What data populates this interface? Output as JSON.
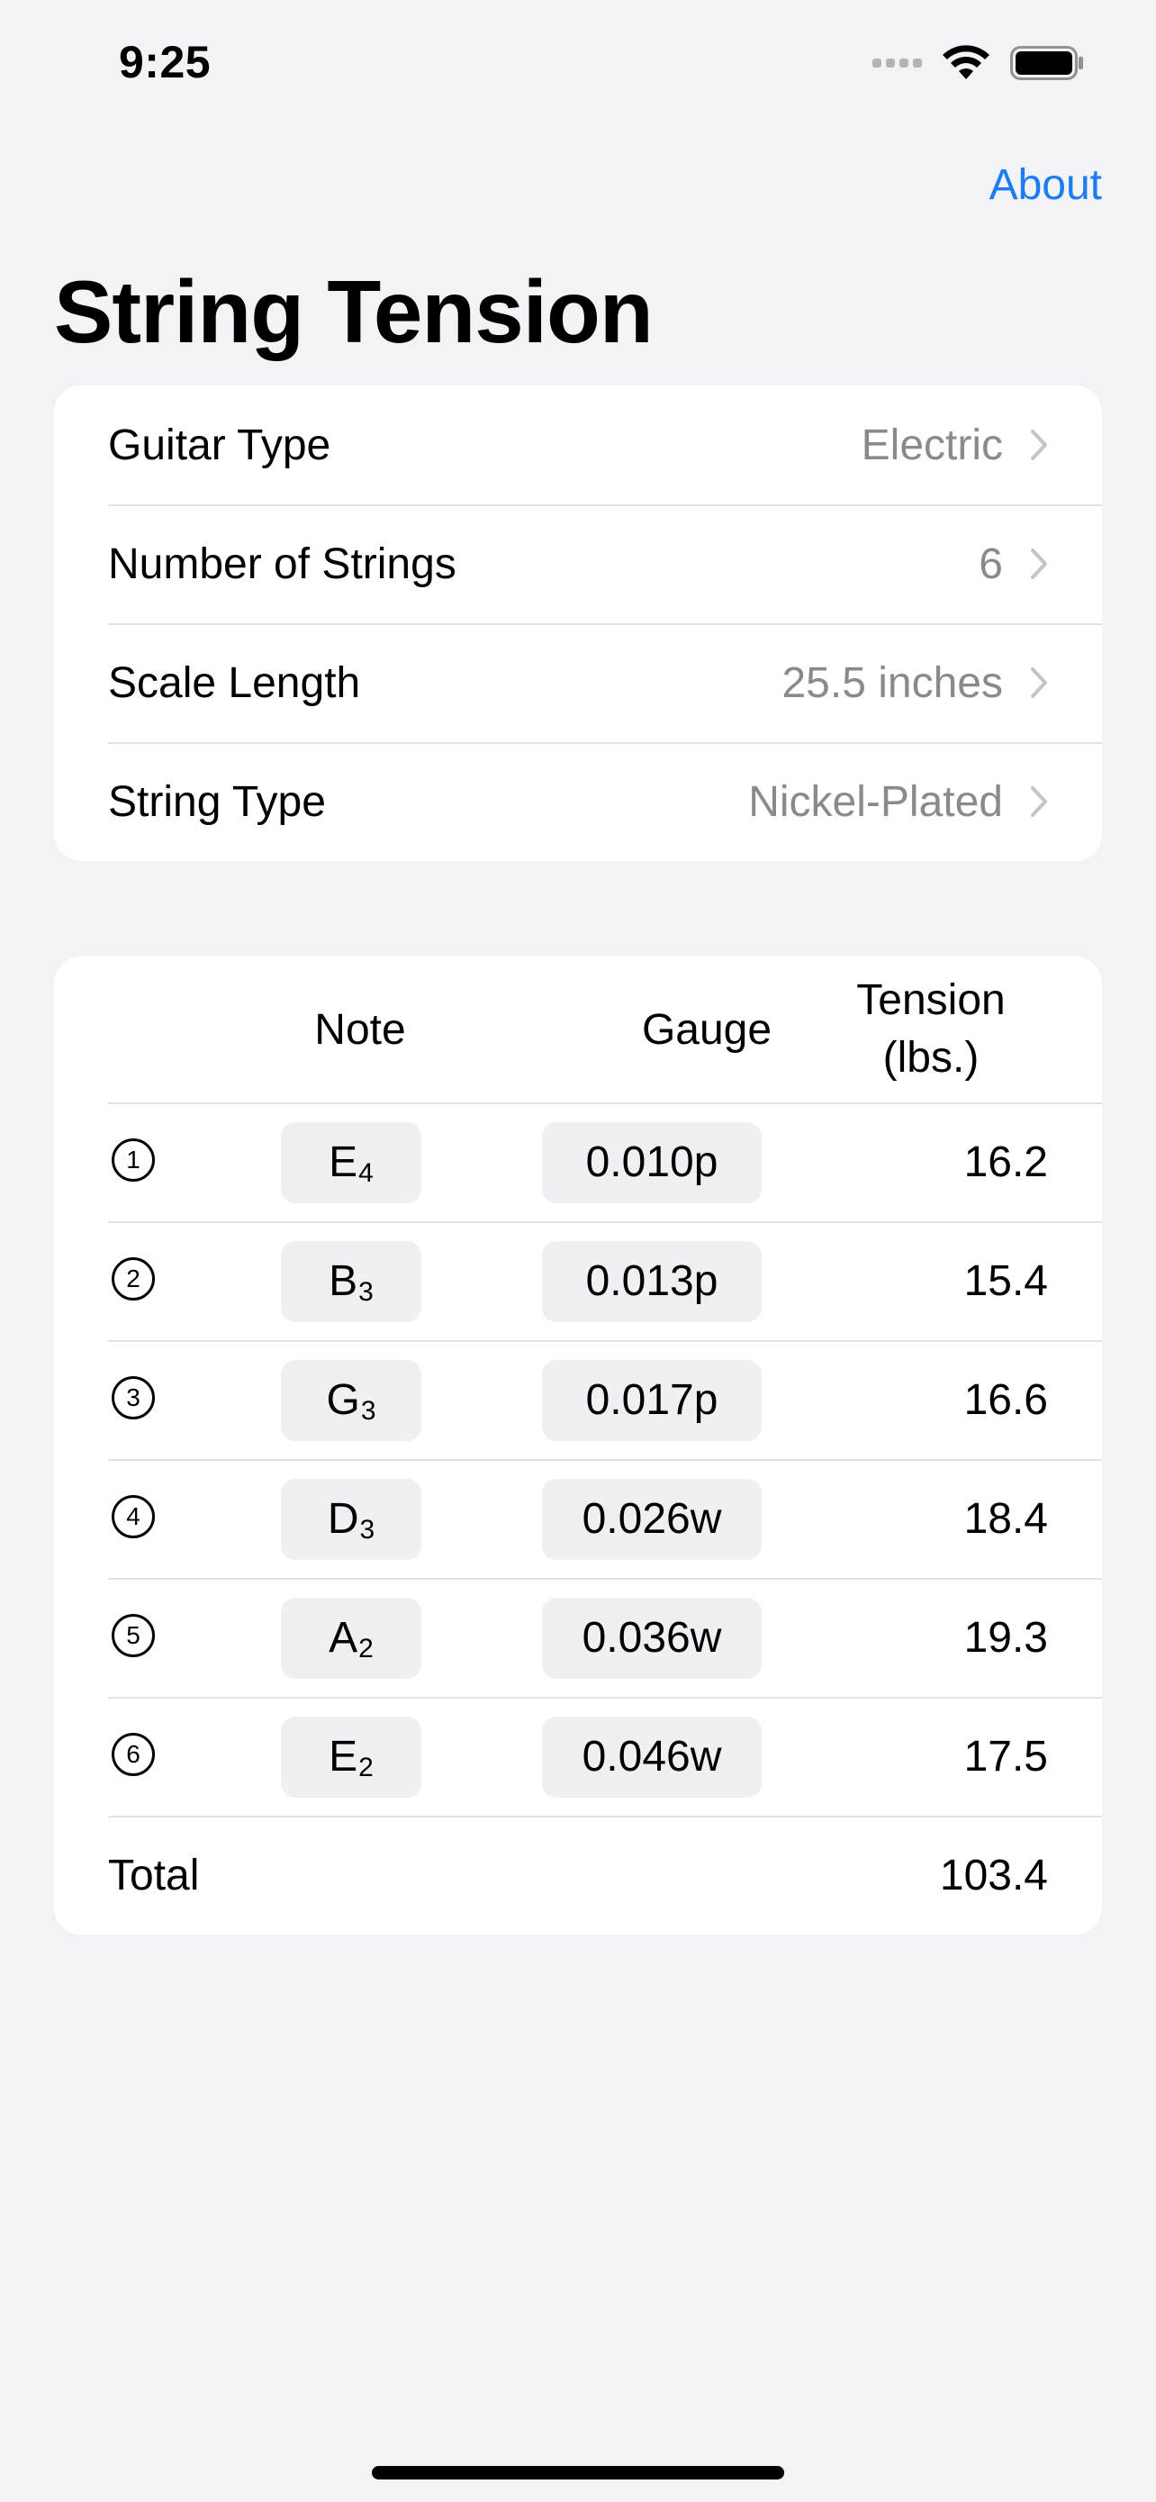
{
  "status_bar": {
    "time": "9:25"
  },
  "nav": {
    "about_label": "About",
    "title": "String Tension"
  },
  "settings": [
    {
      "label": "Guitar Type",
      "value": "Electric"
    },
    {
      "label": "Number of Strings",
      "value": "6"
    },
    {
      "label": "Scale Length",
      "value": "25.5 inches"
    },
    {
      "label": "String Type",
      "value": "Nickel-Plated"
    }
  ],
  "table": {
    "headers": {
      "note": "Note",
      "gauge": "Gauge",
      "tension_line1": "Tension",
      "tension_line2": "(lbs.)"
    },
    "rows": [
      {
        "string": "1",
        "note": "E",
        "octave": "4",
        "gauge": "0.010p",
        "tension": "16.2"
      },
      {
        "string": "2",
        "note": "B",
        "octave": "3",
        "gauge": "0.013p",
        "tension": "15.4"
      },
      {
        "string": "3",
        "note": "G",
        "octave": "3",
        "gauge": "0.017p",
        "tension": "16.6"
      },
      {
        "string": "4",
        "note": "D",
        "octave": "3",
        "gauge": "0.026w",
        "tension": "18.4"
      },
      {
        "string": "5",
        "note": "A",
        "octave": "2",
        "gauge": "0.036w",
        "tension": "19.3"
      },
      {
        "string": "6",
        "note": "E",
        "octave": "2",
        "gauge": "0.046w",
        "tension": "17.5"
      }
    ],
    "total_label": "Total",
    "total_value": "103.4"
  },
  "colors": {
    "accent": "#1C7CF4",
    "background": "#F2F2F7",
    "secondary_text": "#8A8A8E"
  }
}
